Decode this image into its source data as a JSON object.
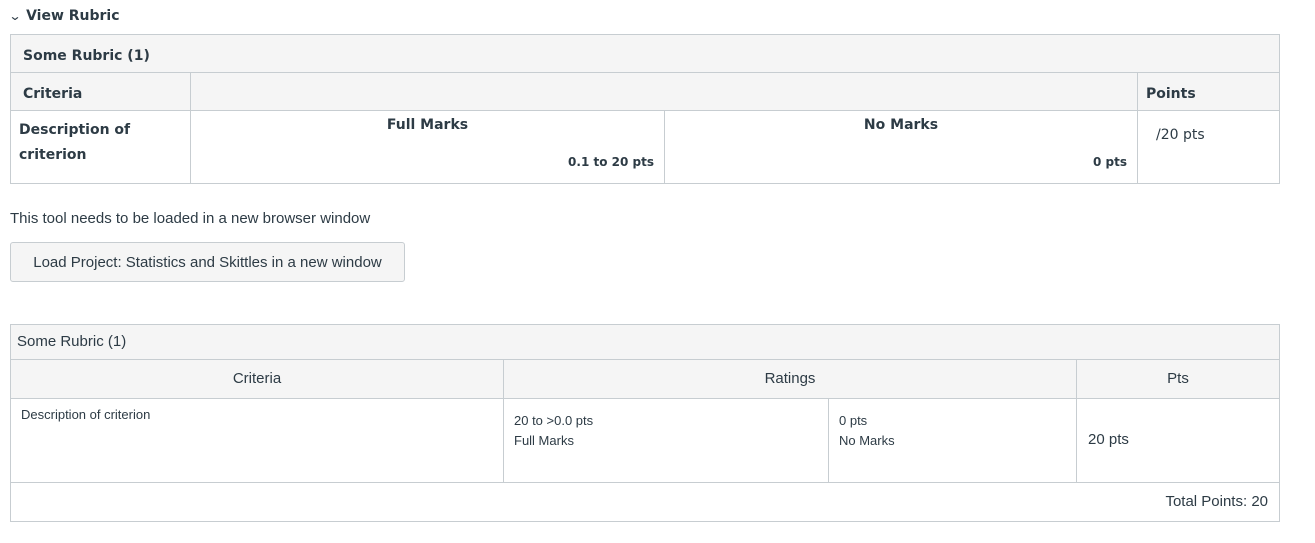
{
  "toggle": {
    "label": "View Rubric",
    "icon": "chevron-down-icon"
  },
  "rubric_top": {
    "title": "Some Rubric (1)",
    "headers": {
      "criteria": "Criteria",
      "points": "Points"
    },
    "row": {
      "description": "Description of criterion",
      "ratings": [
        {
          "title": "Full Marks",
          "points": "0.1 to 20 pts"
        },
        {
          "title": "No Marks",
          "points": "0 pts"
        }
      ],
      "points": "/20 pts"
    }
  },
  "tool_notice": "This tool needs to be loaded in a new browser window",
  "load_button": "Load Project: Statistics and Skittles in a new window",
  "rubric_bottom": {
    "title": "Some Rubric (1)",
    "headers": {
      "criteria": "Criteria",
      "ratings": "Ratings",
      "pts": "Pts"
    },
    "row": {
      "description": "Description of criterion",
      "ratings": [
        {
          "points": "20 to >0.0 pts",
          "title": "Full Marks"
        },
        {
          "points": "0 pts",
          "title": "No Marks"
        }
      ],
      "pts": "20 pts"
    },
    "total": "Total Points: 20"
  }
}
